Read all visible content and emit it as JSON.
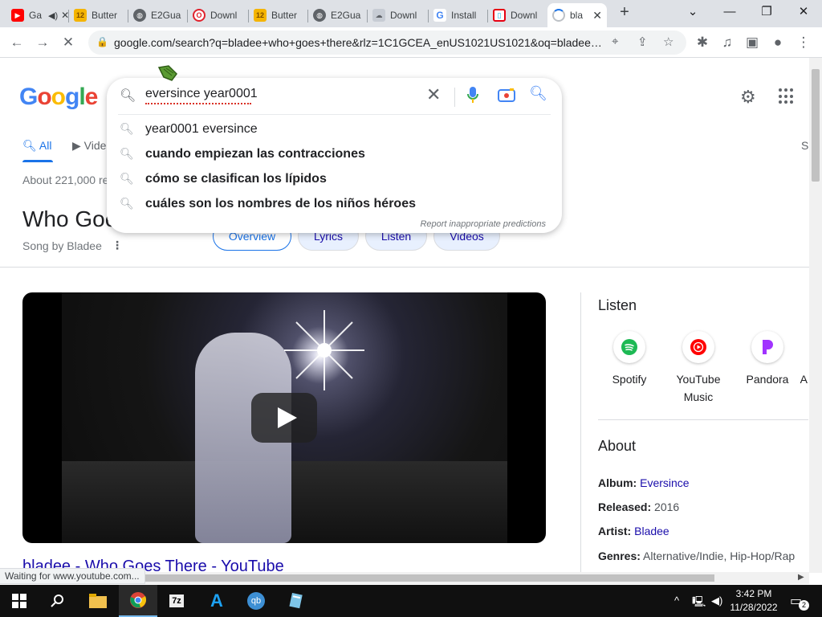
{
  "browser": {
    "tabs": [
      {
        "label": "Ga",
        "favicon": "youtube-icon",
        "muted_icon": "speaker-icon"
      },
      {
        "label": "Butter",
        "favicon": "butter-icon"
      },
      {
        "label": "E2Gua",
        "favicon": "globe-icon"
      },
      {
        "label": "Downl",
        "favicon": "opera-icon"
      },
      {
        "label": "Butter",
        "favicon": "butter-icon"
      },
      {
        "label": "E2Gua",
        "favicon": "globe-icon"
      },
      {
        "label": "Downl",
        "favicon": "cloud-icon"
      },
      {
        "label": "Install",
        "favicon": "google-icon"
      },
      {
        "label": "Downl",
        "favicon": "nintendo-icon"
      },
      {
        "label": "bla",
        "favicon": "loading-icon",
        "active": true
      }
    ],
    "url": "google.com/search?q=bladee+who+goes+there&rlz=1C1GCEA_enUS1021US1021&oq=bladee+...",
    "status_text": "Waiting for www.youtube.com..."
  },
  "google": {
    "logo": "Google",
    "search_value": "eversince year0001",
    "suggestions": [
      {
        "text": "year0001 eversince",
        "bold": false
      },
      {
        "text": "cuando empiezan las contracciones",
        "bold": true
      },
      {
        "text": "cómo se clasifican los lípidos",
        "bold": true
      },
      {
        "text": "cuáles son los nombres de los niños héroes",
        "bold": true
      }
    ],
    "report_label": "Report inappropriate predictions",
    "nav": [
      {
        "label": "All",
        "active": true
      },
      {
        "label": "Vide",
        "active": false
      },
      {
        "label": "S",
        "active": false
      }
    ],
    "results_count": "About 221,000 re",
    "kp_title": "Who Goe",
    "kp_subtitle": "Song by Bladee",
    "chips": [
      "Overview",
      "Lyrics",
      "Listen",
      "Videos"
    ],
    "video_link": "bladee - Who Goes There - YouTube"
  },
  "panel": {
    "listen_heading": "Listen",
    "services": [
      {
        "name": "Spotify",
        "color": "#1db954",
        "icon": "spotify-icon"
      },
      {
        "name": "YouTube Music",
        "color": "#ff0000",
        "icon": "youtube-music-icon"
      },
      {
        "name": "Pandora",
        "color": "#a133ff",
        "icon": "pandora-icon"
      },
      {
        "name": "A",
        "color": "#888888",
        "icon": "more-icon"
      }
    ],
    "about_heading": "About",
    "facts": {
      "album_label": "Album:",
      "album": "Eversince",
      "released_label": "Released:",
      "released": "2016",
      "artist_label": "Artist:",
      "artist": "Bladee",
      "genres_label": "Genres:",
      "genres": "Alternative/Indie, Hip-Hop/Rap"
    }
  },
  "taskbar": {
    "time": "3:42 PM",
    "date": "11/28/2022",
    "notification_count": "2",
    "apps": [
      "file-explorer-icon",
      "chrome-icon",
      "7zip-icon",
      "arc-icon",
      "qbittorrent-icon",
      "notepad-icon"
    ]
  },
  "colors": {
    "accent": "#1a73e8",
    "link": "#1a0dab"
  }
}
